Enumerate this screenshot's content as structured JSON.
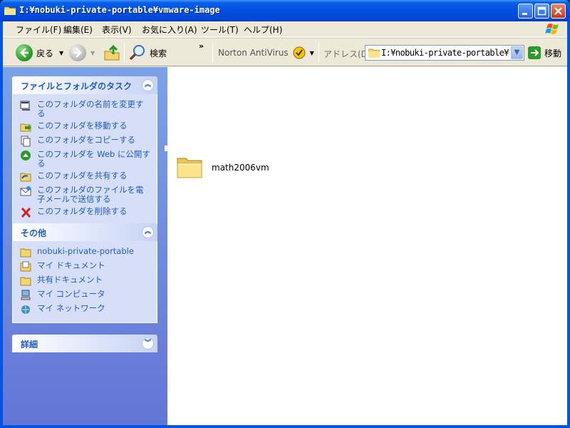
{
  "window": {
    "title": "I:¥nobuki-private-portable¥vmware-image"
  },
  "menubar": {
    "items": [
      "ファイル(F)",
      "編集(E)",
      "表示(V)",
      "お気に入り(A)",
      "ツール(T)",
      "ヘルプ(H)"
    ]
  },
  "toolbar": {
    "back_label": "戻る",
    "search_label": "検索",
    "antivirus_label": "Norton AntiVirus",
    "address_label": "アドレス(D)",
    "address_value": "I:¥nobuki-private-portable¥vmware-image",
    "go_label": "移動"
  },
  "tasks": {
    "title": "ファイルとフォルダのタスク",
    "items": [
      {
        "label": "このフォルダの名前を変更する",
        "icon": "rename-icon"
      },
      {
        "label": "このフォルダを移動する",
        "icon": "move-icon"
      },
      {
        "label": "このフォルダをコピーする",
        "icon": "copy-icon"
      },
      {
        "label": "このフォルダを Web に公開する",
        "icon": "web-publish-icon"
      },
      {
        "label": "このフォルダを共有する",
        "icon": "share-icon"
      },
      {
        "label": "このフォルダのファイルを電子メールで送信する",
        "icon": "email-icon"
      },
      {
        "label": "このフォルダを削除する",
        "icon": "delete-icon"
      }
    ]
  },
  "other_places": {
    "title": "その他",
    "items": [
      {
        "label": "nobuki-private-portable",
        "icon": "folder-icon"
      },
      {
        "label": "マイ ドキュメント",
        "icon": "my-documents-icon"
      },
      {
        "label": "共有ドキュメント",
        "icon": "shared-documents-icon"
      },
      {
        "label": "マイ コンピュータ",
        "icon": "my-computer-icon"
      },
      {
        "label": "マイ ネットワーク",
        "icon": "my-network-icon"
      }
    ]
  },
  "details": {
    "title": "詳細"
  },
  "files": [
    {
      "name": "math2006vm",
      "type": "folder"
    }
  ],
  "colors": {
    "titlebar": "#0054e3",
    "link": "#215dc6",
    "panel": "#7ba2e7"
  }
}
